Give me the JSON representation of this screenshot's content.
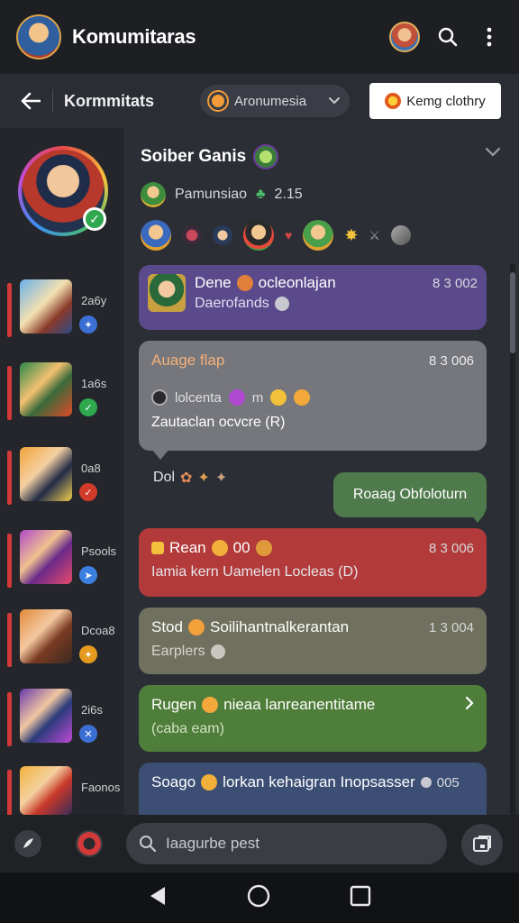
{
  "app": {
    "title": "Komumitaras"
  },
  "subbar": {
    "title": "Kormmitats",
    "dropdown_label": "Aronumesia",
    "action_label": "Kemg clothry"
  },
  "group": {
    "title": "Soiber Ganis",
    "meta_label": "Pamunsiao",
    "meta_value": "2.15"
  },
  "rail": {
    "items": [
      {
        "count": "2a6y",
        "badge_color": "#3b6fd4"
      },
      {
        "count": "1a6s",
        "badge_color": "#2fa84f"
      },
      {
        "count": "0a8",
        "badge_color": "#d23a2a"
      },
      {
        "count": "Psools",
        "badge_color": "#3b7fe0"
      },
      {
        "count": "Dcoa8",
        "badge_color": "#e59a1e"
      },
      {
        "count": "2i6s",
        "badge_color": "#3b6fd4"
      },
      {
        "count": "Faonos",
        "badge_color": "#d23a3a"
      }
    ]
  },
  "messages": {
    "purple": {
      "title": "Dene",
      "title_tail": "ocleonlajan",
      "time": "8 3 002",
      "sub": "Daerofands"
    },
    "gray": {
      "title": "Auage flap",
      "time": "8 3 006",
      "mid": "lolcenta",
      "mid_tail": "m",
      "body": "Zautaclan ocvcre (R)"
    },
    "react_label": "Dol",
    "green_bubble": "Roaag Obfoloturn",
    "red": {
      "title": "Rean",
      "title_tail": "00",
      "time": "8 3 006",
      "body": "Iamia kern Uamelen Locleas (D)"
    },
    "olive": {
      "title": "Stod",
      "title_tail": "Soilihantnalkerantan",
      "time": "1 3 004",
      "body": "Earplers"
    },
    "green": {
      "title": "Rugen",
      "title_tail": "nieaa lanreanentitame",
      "body": "(caba eam)"
    },
    "blue": {
      "title": "Soago",
      "title_tail": "lorkan kehaigran Inopsasser",
      "time": "005"
    }
  },
  "composer": {
    "placeholder": "Iaagurbe pest"
  },
  "colors": {
    "accent_red": "#d23a3a",
    "card_purple": "#5a4a8c",
    "card_gray": "#75777c",
    "card_red": "#b23a3a",
    "card_olive": "#70705e",
    "card_green": "#4f7e3a",
    "card_blue": "#3c4e74",
    "bubble_green": "#4f7a4c"
  }
}
